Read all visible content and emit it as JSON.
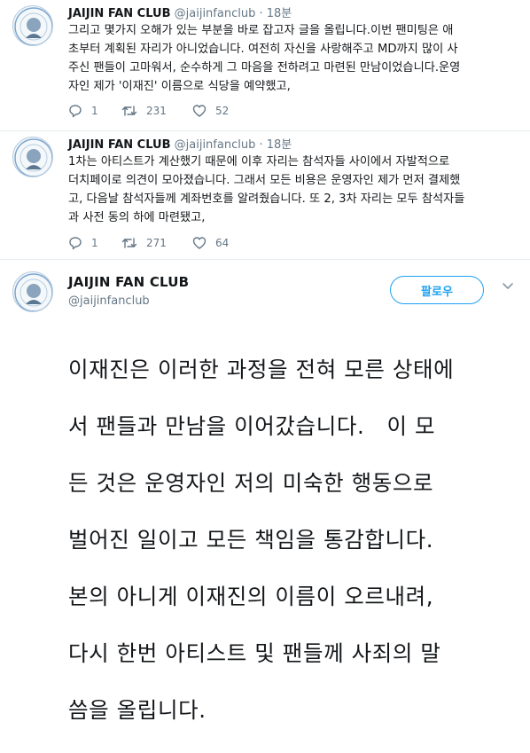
{
  "tweets": [
    {
      "name": "JAIJIN FAN CLUB",
      "handle": "@jaijinfanclub",
      "separator": "·",
      "time": "18분",
      "lines": [
        "그리고 몇가지 오해가 있는 부분을 바로 잡고자 글을 올립니다.이번 팬미팅은 애",
        "초부터 계획된 자리가 아니었습니다. 여전히 자신을 사랑해주고 MD까지 많이 사",
        "주신 팬들이 고마워서, 순수하게 그 마음을 전하려고 마련된 만남이었습니다.운영",
        "자인 제가 '이재진' 이름으로 식당을 예약했고,"
      ],
      "replies": "1",
      "retweets": "231",
      "likes": "52"
    },
    {
      "name": "JAIJIN FAN CLUB",
      "handle": "@jaijinfanclub",
      "separator": "·",
      "time": "18분",
      "lines": [
        "1차는 아티스트가 계산했기 때문에 이후 자리는 참석자들 사이에서 자발적으로",
        "더치페이로 의견이 모아졌습니다. 그래서 모든 비용은 운영자인 제가 먼저 결제했",
        "고, 다음날 참석자들께 계좌번호를 알려줬습니다. 또 2, 3차 자리는 모두 참석자들",
        "과 사전 동의 하에 마련됐고,"
      ],
      "replies": "1",
      "retweets": "271",
      "likes": "64"
    }
  ],
  "main_tweet": {
    "name": "JAIJIN FAN CLUB",
    "handle": "@jaijinfanclub",
    "follow_label": "팔로우",
    "lines": [
      "이재진은 이러한 과정을 전혀 모른 상태에",
      "서 팬들과 만남을 이어갔습니다.   이 모",
      "든 것은 운영자인 저의 미숙한 행동으로",
      "벌어진 일이고 모든 책임을 통감합니다.",
      "본의 아니게 이재진의 이름이 오르내려,",
      "다시 한번 아티스트 및 팬들께 사죄의 말",
      "씀을 올립니다."
    ]
  },
  "colors": {
    "accent": "#1da1f2",
    "secondary_text": "#657786",
    "divider": "#e6ecf0"
  },
  "icons": [
    "avatar-image",
    "reply-icon",
    "retweet-icon",
    "like-icon",
    "chevron-down-icon"
  ]
}
